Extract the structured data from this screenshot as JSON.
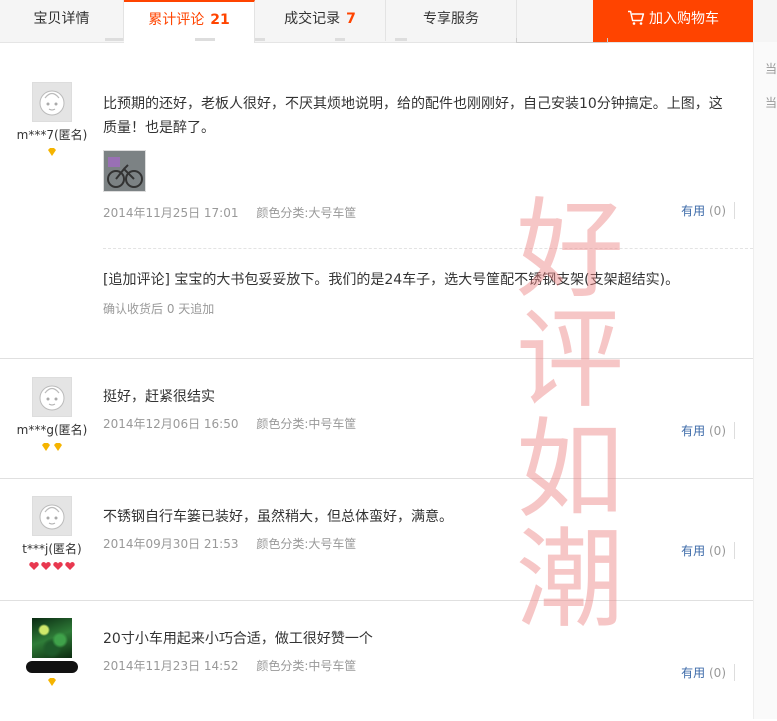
{
  "tabs": [
    {
      "label": "宝贝详情",
      "count": ""
    },
    {
      "label": "累计评论",
      "count": "21"
    },
    {
      "label": "成交记录",
      "count": "7"
    },
    {
      "label": "专享服务",
      "count": ""
    }
  ],
  "cart_button": "加入购物车",
  "side_column": [
    "当",
    "当"
  ],
  "reviews": [
    {
      "user": "m***7(匿名)",
      "content": "比预期的还好，老板人很好，不厌其烦地说明，给的配件也刚刚好，自己安装10分钟搞定。上图，这质量！也是醉了。",
      "date": "2014年11月25日 17:01",
      "sku": "颜色分类:大号车筐",
      "useful_label": "有用",
      "useful_count": "(0)",
      "append_text": "[追加评论] 宝宝的大书包妥妥放下。我们的是24车子，选大号筐配不锈钢支架(支架超结实)。",
      "append_meta": "确认收货后 0 天追加"
    },
    {
      "user": "m***g(匿名)",
      "content": "挺好，赶紧很结实",
      "date": "2014年12月06日 16:50",
      "sku": "颜色分类:中号车筐",
      "useful_label": "有用",
      "useful_count": "(0)"
    },
    {
      "user": "t***j(匿名)",
      "content": "不锈钢自行车篓已装好，虽然稍大，但总体蛮好，满意。",
      "date": "2014年09月30日 21:53",
      "sku": "颜色分类:大号车筐",
      "useful_label": "有用",
      "useful_count": "(0)"
    },
    {
      "user": "",
      "content": "20寸小车用起来小巧合适，做工很好赞一个",
      "date": "2014年11月23日 14:52",
      "sku": "颜色分类:中号车筐",
      "useful_label": "有用",
      "useful_count": "(0)"
    }
  ],
  "watermark": [
    "好",
    "评",
    "如",
    "潮"
  ],
  "colors": {
    "accent": "#ff4400",
    "link_blue": "#3c6aa8",
    "gem_yellow": "#f5b400",
    "gem_red": "#e8384f",
    "watermark": "#ec8080"
  }
}
